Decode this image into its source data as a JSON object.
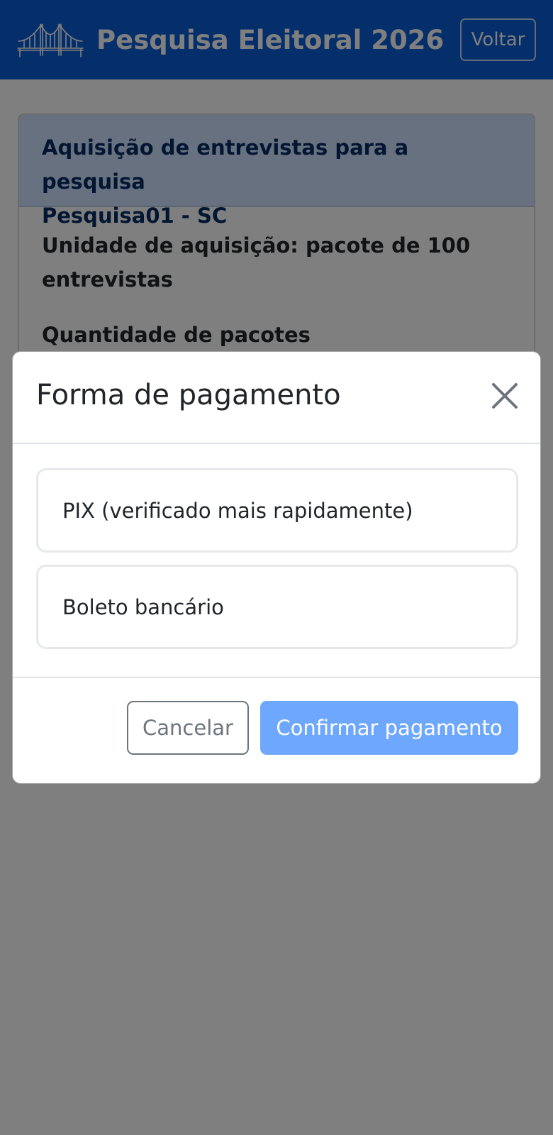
{
  "navbar": {
    "title": "Pesquisa Eleitoral 2026",
    "logo_icon": "bridge-logo-icon",
    "back_label": "Voltar",
    "color": "#0b5ed7"
  },
  "card": {
    "header_line1": "Aquisição de entrevistas para a pesquisa",
    "header_line2": "Pesquisa01 - SC",
    "unit_line1": "Unidade de aquisição: pacote de 100",
    "unit_line2": "entrevistas",
    "quantity_label": "Quantidade de pacotes"
  },
  "modal": {
    "title": "Forma de pagamento",
    "close_icon": "close-icon",
    "options": [
      {
        "label": "PIX (verificado mais rapidamente)"
      },
      {
        "label": "Boleto bancário"
      }
    ],
    "cancel_label": "Cancelar",
    "confirm_label": "Confirmar pagamento",
    "confirm_color": "#6ea8fe"
  }
}
